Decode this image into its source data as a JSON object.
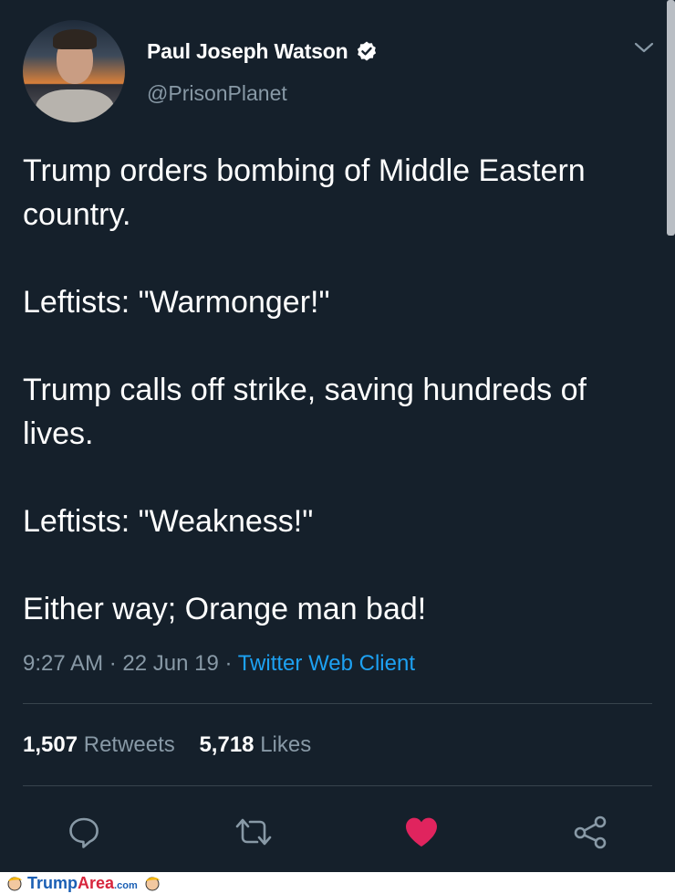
{
  "tweet": {
    "author_name": "Paul Joseph Watson",
    "author_handle": "@PrisonPlanet",
    "verified": true,
    "lines": [
      "Trump orders bombing of Middle Eastern country.",
      "",
      "Leftists: \"Warmonger!\"",
      "",
      "Trump calls off strike, saving hundreds of lives.",
      "",
      "Leftists: \"Weakness!\"",
      "",
      "Either way; Orange man bad!"
    ],
    "time": "9:27 AM",
    "date": "22 Jun 19",
    "separator": " · ",
    "client": "Twitter Web Client",
    "retweets_count": "1,507",
    "retweets_label": "Retweets",
    "likes_count": "5,718",
    "likes_label": "Likes"
  },
  "actions": {
    "reply_icon": "reply-icon",
    "retweet_icon": "retweet-icon",
    "like_icon": "heart-icon",
    "share_icon": "share-icon"
  },
  "colors": {
    "background": "#15202b",
    "secondary_text": "#8899a6",
    "link": "#1da1f2",
    "like": "#e0245e"
  },
  "footer": {
    "brand_main": "Trump",
    "brand_accent": "Area",
    "brand_suffix": ".com"
  }
}
